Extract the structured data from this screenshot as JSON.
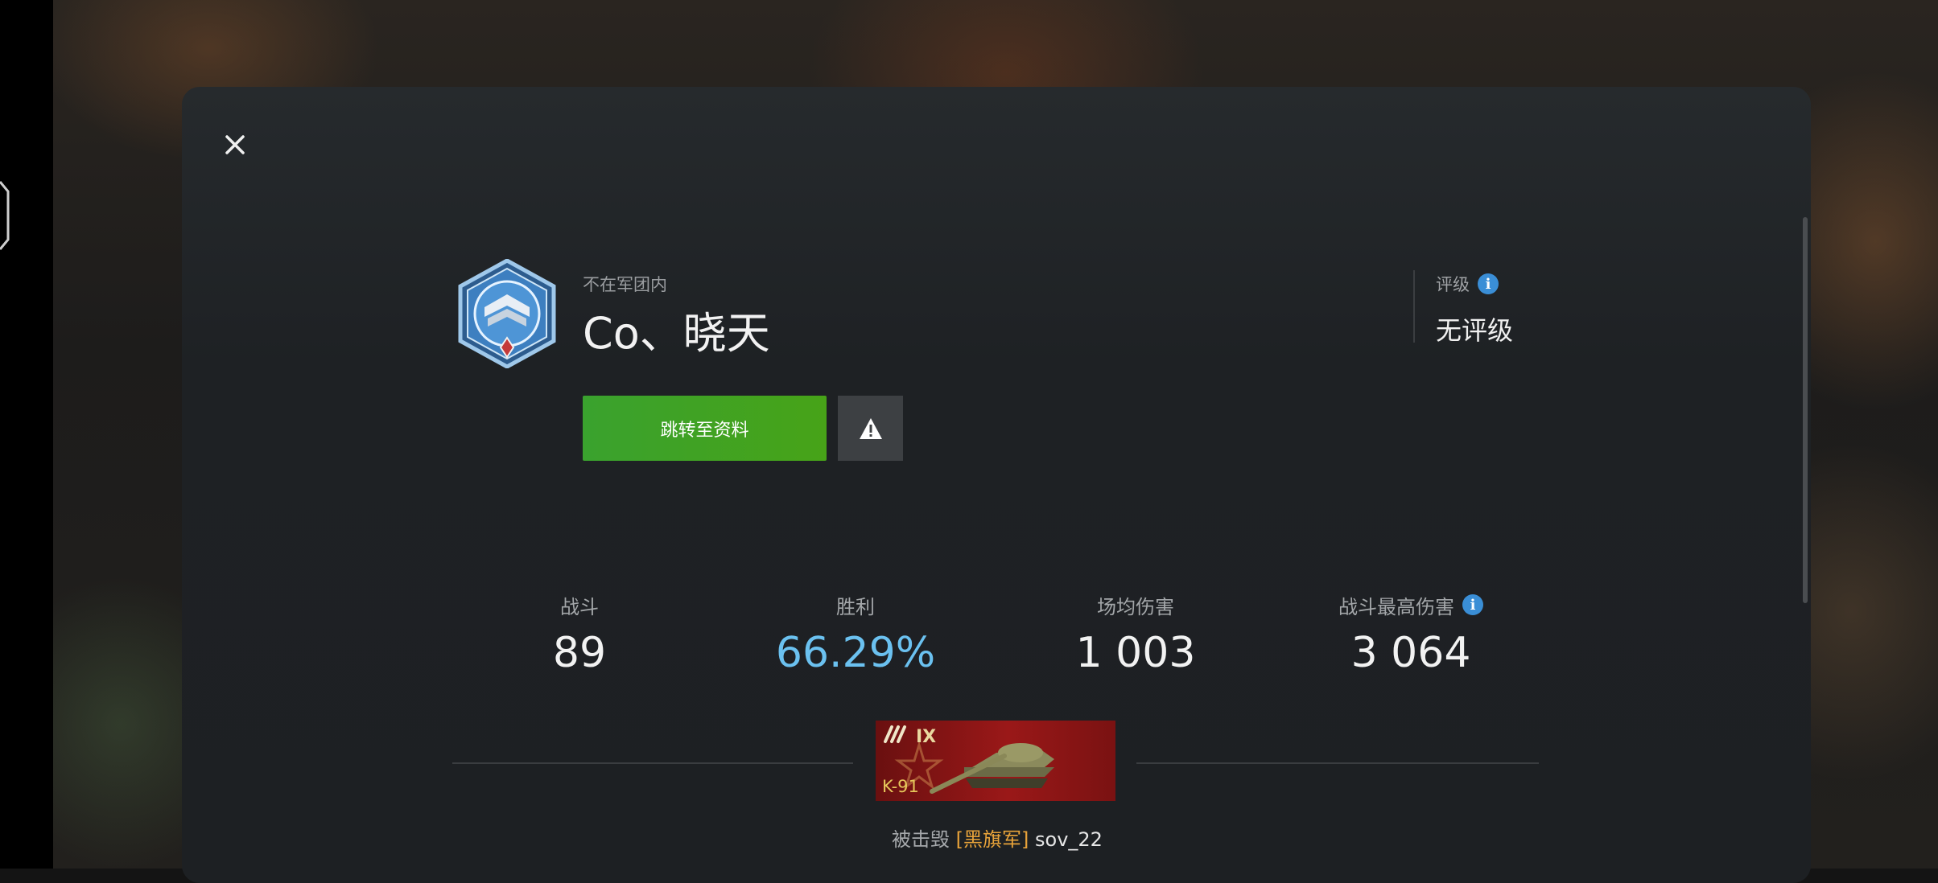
{
  "colors": {
    "accent_green": "#3aa22e",
    "winrate_blue": "#6bc1f0",
    "info_blue": "#3a8ed6",
    "clan_tag_orange": "#e8a33a",
    "tank_card_red": "#9a1818"
  },
  "dialog": {
    "close_icon": "close-icon"
  },
  "player": {
    "clan_status": "不在军团内",
    "name": "Co、晓天",
    "badge_icon": "rank-badge-icon"
  },
  "rating": {
    "label": "评级",
    "value": "无评级",
    "info_icon": "info-icon"
  },
  "actions": {
    "profile_label": "跳转至资料",
    "report_icon": "warning-icon"
  },
  "stats": [
    {
      "label": "战斗",
      "value": "89"
    },
    {
      "label": "胜利",
      "value": "66.29%"
    },
    {
      "label": "场均伤害",
      "value": "1 003"
    },
    {
      "label": "战斗最高伤害",
      "value": "3 064"
    }
  ],
  "last_battle": {
    "tank_tier": "IX",
    "tank_name": "K-91",
    "killed_by_label": "被击毁",
    "killer_clan": "[黑旗军]",
    "killer_name": "sov_22"
  }
}
